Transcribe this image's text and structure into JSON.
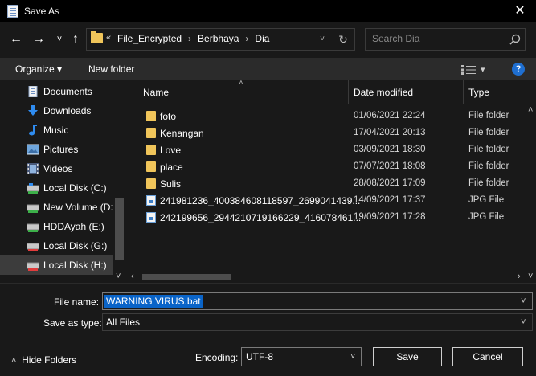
{
  "window": {
    "title": "Save As",
    "close_glyph": "✕"
  },
  "nav": {
    "back_glyph": "←",
    "forward_glyph": "→",
    "recent_glyph": "˅",
    "up_glyph": "↑",
    "address": {
      "overflow": "«",
      "crumbs": [
        "File_Encrypted",
        "Berbhaya",
        "Dia"
      ],
      "dropdown_glyph": "˅",
      "refresh_glyph": "↻"
    },
    "search_placeholder": "Search Dia"
  },
  "toolbar": {
    "organize_label": "Organize",
    "organize_caret": "▾",
    "new_folder_label": "New folder",
    "view_caret": "▾",
    "help_label": "?"
  },
  "sidebar": {
    "items": [
      {
        "label": "Documents",
        "icon": "documents-icon"
      },
      {
        "label": "Downloads",
        "icon": "downloads-icon"
      },
      {
        "label": "Music",
        "icon": "music-icon"
      },
      {
        "label": "Pictures",
        "icon": "pictures-icon"
      },
      {
        "label": "Videos",
        "icon": "videos-icon"
      },
      {
        "label": "Local Disk (C:)",
        "icon": "drive-icon"
      },
      {
        "label": "New Volume (D:",
        "icon": "drive-icon"
      },
      {
        "label": "HDDAyah (E:)",
        "icon": "drive-icon"
      },
      {
        "label": "Local Disk (G:)",
        "icon": "drive-icon"
      },
      {
        "label": "Local Disk (H:)",
        "icon": "drive-icon",
        "selected": true
      }
    ],
    "scroll_up": "˄",
    "scroll_down": "˅"
  },
  "filelist": {
    "columns": {
      "name": "Name",
      "date": "Date modified",
      "type": "Type"
    },
    "sort_indicator": "˄",
    "rows": [
      {
        "name": "foto",
        "date": "01/06/2021 22:24",
        "type": "File folder",
        "kind": "folder"
      },
      {
        "name": "Kenangan",
        "date": "17/04/2021 20:13",
        "type": "File folder",
        "kind": "folder"
      },
      {
        "name": "Love",
        "date": "03/09/2021 18:30",
        "type": "File folder",
        "kind": "folder"
      },
      {
        "name": "place",
        "date": "07/07/2021 18:08",
        "type": "File folder",
        "kind": "folder"
      },
      {
        "name": "Sulis",
        "date": "28/08/2021 17:09",
        "type": "File folder",
        "kind": "folder"
      },
      {
        "name": "241981236_400384608118597_2699041439...",
        "date": "14/09/2021 17:37",
        "type": "JPG File",
        "kind": "jpg"
      },
      {
        "name": "242199656_2944210719166229_416078461...",
        "date": "19/09/2021 17:28",
        "type": "JPG File",
        "kind": "jpg"
      }
    ],
    "vscroll_up": "˄",
    "vscroll_down": "˅",
    "hscroll_left": "‹",
    "hscroll_right": "›"
  },
  "form": {
    "filename_label": "File name:",
    "filename_value": "WARNING VIRUS.bat",
    "savetype_label": "Save as type:",
    "savetype_value": "All Files",
    "dropdown_glyph": "˅"
  },
  "footer": {
    "hide_folders_glyph": "˄",
    "hide_folders_label": "Hide Folders",
    "encoding_label": "Encoding:",
    "encoding_value": "UTF-8",
    "save_label": "Save",
    "cancel_label": "Cancel"
  },
  "colors": {
    "accent": "#0a64c8",
    "background": "#191919",
    "toolbar": "#2b2b2b",
    "folder": "#f0c55a",
    "help": "#1f6fd1"
  }
}
